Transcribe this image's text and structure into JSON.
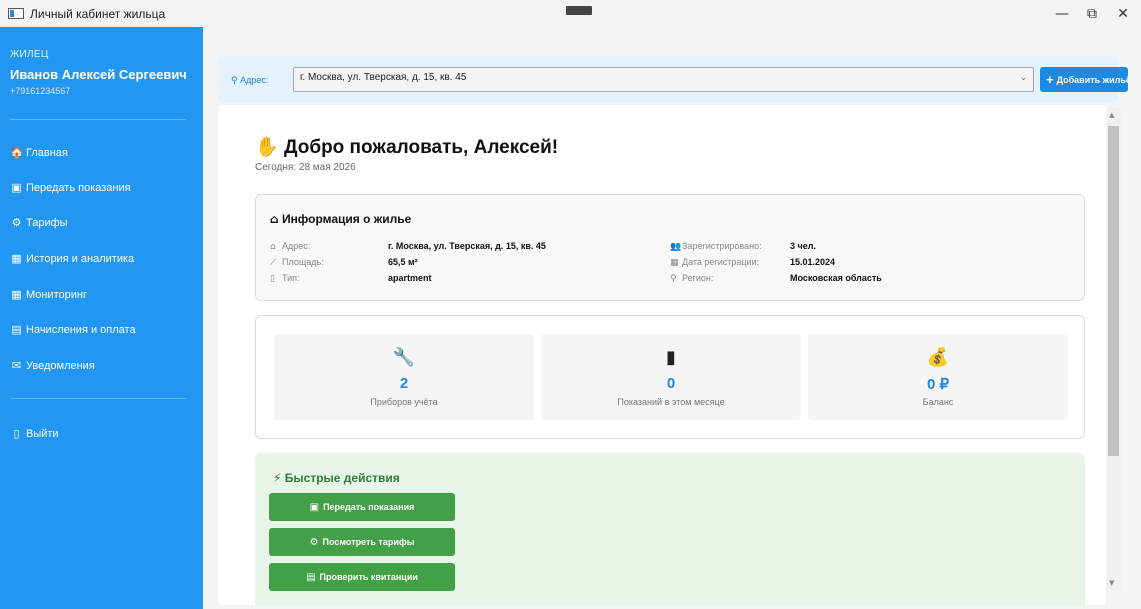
{
  "window": {
    "title": "Личный кабинет жильца",
    "minimize_glyph": "—",
    "maximize_glyph": "⧉",
    "close_glyph": "✕"
  },
  "sidebar": {
    "role": "ЖИЛЕЦ",
    "user_name": "Иванов Алексей Сергеевич",
    "phone": "+79161234567",
    "items": [
      {
        "icon": "🏠",
        "icon_name": "home-icon",
        "label": "Главная"
      },
      {
        "icon": "▣",
        "icon_name": "meter-icon",
        "label": "Передать показания"
      },
      {
        "icon": "⚙",
        "icon_name": "money-bag-icon",
        "label": "Тарифы"
      },
      {
        "icon": "▦",
        "icon_name": "chart-icon",
        "label": "История и аналитика"
      },
      {
        "icon": "▦",
        "icon_name": "monitor-chart-icon",
        "label": "Мониторинг"
      },
      {
        "icon": "▤",
        "icon_name": "receipt-icon",
        "label": "Начисления и оплата"
      },
      {
        "icon": "✉",
        "icon_name": "bell-icon",
        "label": "Уведомления"
      }
    ],
    "logout": {
      "icon": "▯",
      "icon_name": "door-icon",
      "label": "Выйти"
    }
  },
  "address_bar": {
    "label": "Адрес:",
    "selected": "г. Москва, ул. Тверская, д. 15, кв. 45",
    "add_button": "Добавить жильё"
  },
  "welcome": {
    "title": "Добро пожаловать, Алексей!",
    "today": "Сегодня: 28 мая 2026"
  },
  "housing_info": {
    "heading": "Информация о жилье",
    "left": [
      {
        "label": "Адрес:",
        "value": "г. Москва, ул. Тверская, д. 15, кв. 45",
        "icon": "⌂"
      },
      {
        "label": "Площадь:",
        "value": "65,5 м²",
        "icon": "⟋"
      },
      {
        "label": "Тип:",
        "value": "apartment",
        "icon": "▯"
      }
    ],
    "right": [
      {
        "label": "Зарегистрировано:",
        "value": "3 чел.",
        "icon": "👥"
      },
      {
        "label": "Дата регистрации:",
        "value": "15.01.2024",
        "icon": "▦"
      },
      {
        "label": "Регион:",
        "value": "Московская область",
        "icon": "⚲"
      }
    ]
  },
  "stats": [
    {
      "icon": "🔧",
      "icon_name": "wrench-icon",
      "value": "2",
      "label": "Приборов учёта"
    },
    {
      "icon": "▮",
      "icon_name": "bar-chart-icon",
      "value": "0",
      "label": "Показаний в этом месяце"
    },
    {
      "icon": "💰",
      "icon_name": "money-bag-icon",
      "value": "0 ₽",
      "label": "Баланс"
    }
  ],
  "quick_actions": {
    "heading": "Быстрые действия",
    "buttons": [
      {
        "icon": "▣",
        "icon_name": "meter-icon",
        "label": "Передать показания"
      },
      {
        "icon": "⚙",
        "icon_name": "money-bag-icon",
        "label": "Посмотреть тарифы"
      },
      {
        "icon": "▤",
        "icon_name": "receipt-icon",
        "label": "Проверить квитанции"
      }
    ]
  },
  "colors": {
    "sidebar": "#2196f3",
    "accent": "#1e88e5",
    "success": "#43a047",
    "quick_bg": "#e8f5e9"
  }
}
